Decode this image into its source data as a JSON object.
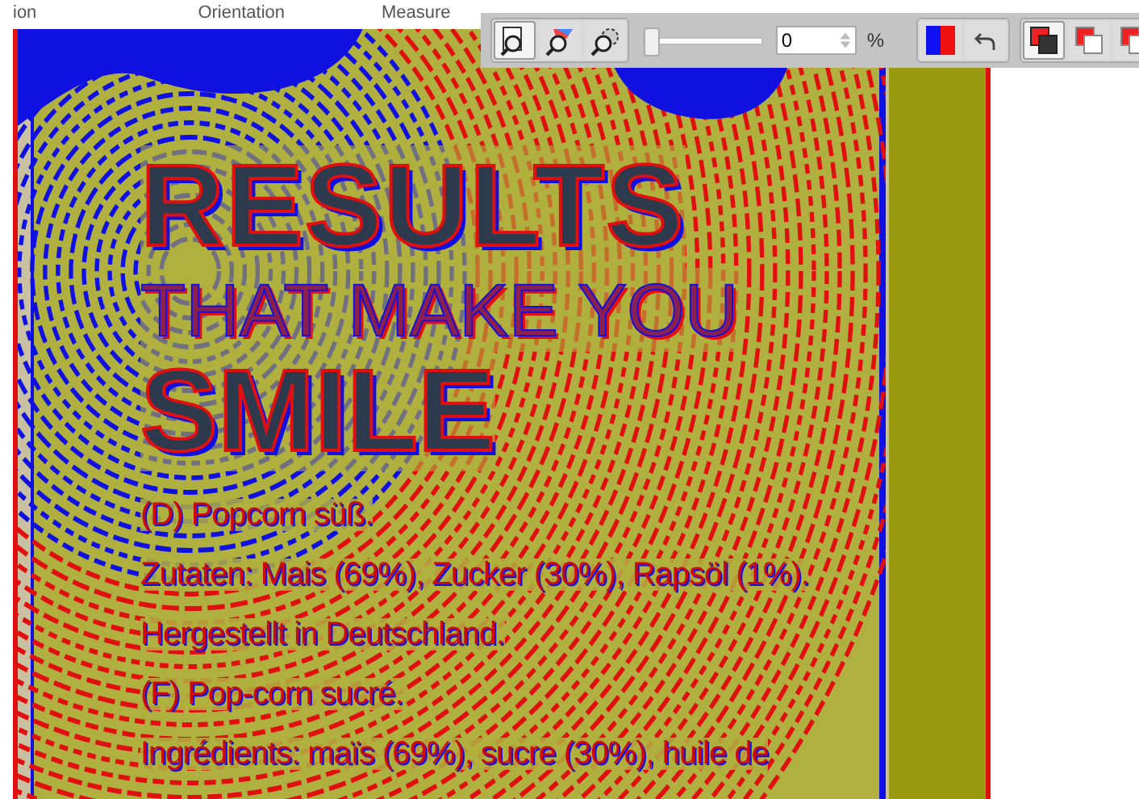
{
  "header": {
    "labels": [
      "ion",
      "Orientation",
      "Measure"
    ]
  },
  "toolbar": {
    "slider": {
      "level": 0
    },
    "value": "0",
    "unit": "%"
  },
  "document": {
    "headline": "RESULTS",
    "subhead": "THAT MAKE YOU",
    "tagline": "SMILE",
    "lines": [
      "(D) Popcorn süß.",
      "Zutaten: Mais (69%), Zucker (30%), Rapsöl (1%).",
      "Hergestellt in Deutschland.",
      "(F) Pop-corn sucré.",
      "Ingrédients: maïs (69%), sucre (30%), huile de"
    ]
  }
}
